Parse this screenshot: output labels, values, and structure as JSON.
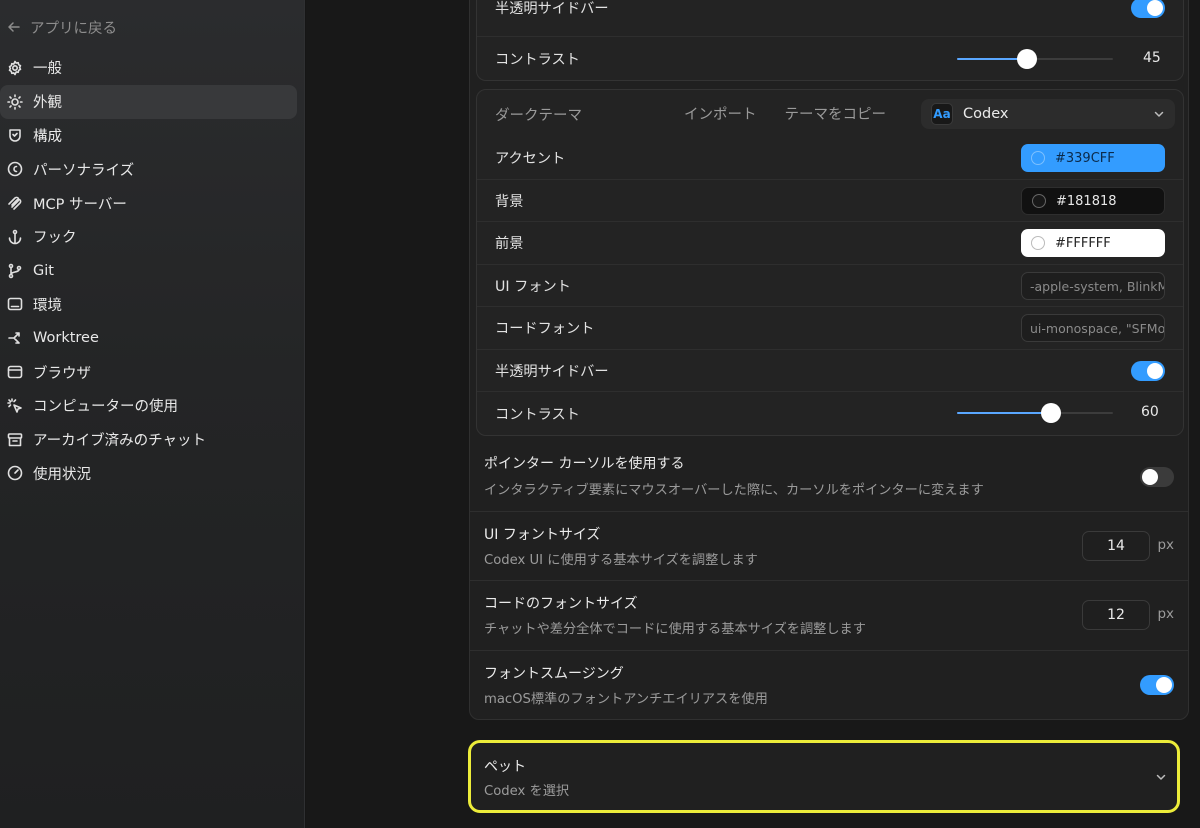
{
  "sidebar": {
    "back_label": "アプリに戻る",
    "items": [
      {
        "label": "一般",
        "icon": "gear-icon"
      },
      {
        "label": "外観",
        "icon": "sun-icon",
        "active": true
      },
      {
        "label": "構成",
        "icon": "config-shield-icon"
      },
      {
        "label": "パーソナライズ",
        "icon": "personalize-icon"
      },
      {
        "label": "MCP サーバー",
        "icon": "mcp-icon"
      },
      {
        "label": "フック",
        "icon": "anchor-icon"
      },
      {
        "label": "Git",
        "icon": "git-branch-icon"
      },
      {
        "label": "環境",
        "icon": "terminal-icon"
      },
      {
        "label": "Worktree",
        "icon": "worktree-icon"
      },
      {
        "label": "ブラウザ",
        "icon": "browser-icon"
      },
      {
        "label": "コンピューターの使用",
        "icon": "cursor-click-icon"
      },
      {
        "label": "アーカイブ済みのチャット",
        "icon": "archive-icon"
      },
      {
        "label": "使用状況",
        "icon": "gauge-icon"
      }
    ]
  },
  "light_theme": {
    "translucent_sidebar_label": "半透明サイドバー",
    "translucent_sidebar_on": true,
    "contrast_label": "コントラスト",
    "contrast_value": "45",
    "contrast_fraction": 0.45
  },
  "dark_theme": {
    "title": "ダークテーマ",
    "import_label": "インポート",
    "copy_label": "テーマをコピー",
    "theme_badge": "Aa",
    "theme_name": "Codex",
    "accent_label": "アクセント",
    "accent_value": "#339CFF",
    "background_label": "背景",
    "background_value": "#181818",
    "foreground_label": "前景",
    "foreground_value": "#FFFFFF",
    "ui_font_label": "UI フォント",
    "ui_font_value": "-apple-system, BlinkMacSystemFont",
    "code_font_label": "コードフォント",
    "code_font_value": "ui-monospace, \"SFMono-Regular\"",
    "translucent_sidebar_label": "半透明サイドバー",
    "translucent_sidebar_on": true,
    "contrast_label": "コントラスト",
    "contrast_value": "60",
    "contrast_fraction": 0.6
  },
  "settings": {
    "pointer_cursor": {
      "title": "ポインター カーソルを使用する",
      "desc": "インタラクティブ要素にマウスオーバーした際に、カーソルをポインターに変えます",
      "on": false
    },
    "ui_font_size": {
      "title": "UI フォントサイズ",
      "desc": "Codex UI に使用する基本サイズを調整します",
      "value": "14",
      "unit": "px"
    },
    "code_font_size": {
      "title": "コードのフォントサイズ",
      "desc": "チャットや差分全体でコードに使用する基本サイズを調整します",
      "value": "12",
      "unit": "px"
    },
    "font_smoothing": {
      "title": "フォントスムージング",
      "desc": "macOS標準のフォントアンチエイリアスを使用",
      "on": true
    }
  },
  "pet": {
    "title": "ペット",
    "desc": "Codex を選択"
  },
  "colors": {
    "accent": "#339CFF",
    "highlight_border": "#ECEC3A"
  }
}
